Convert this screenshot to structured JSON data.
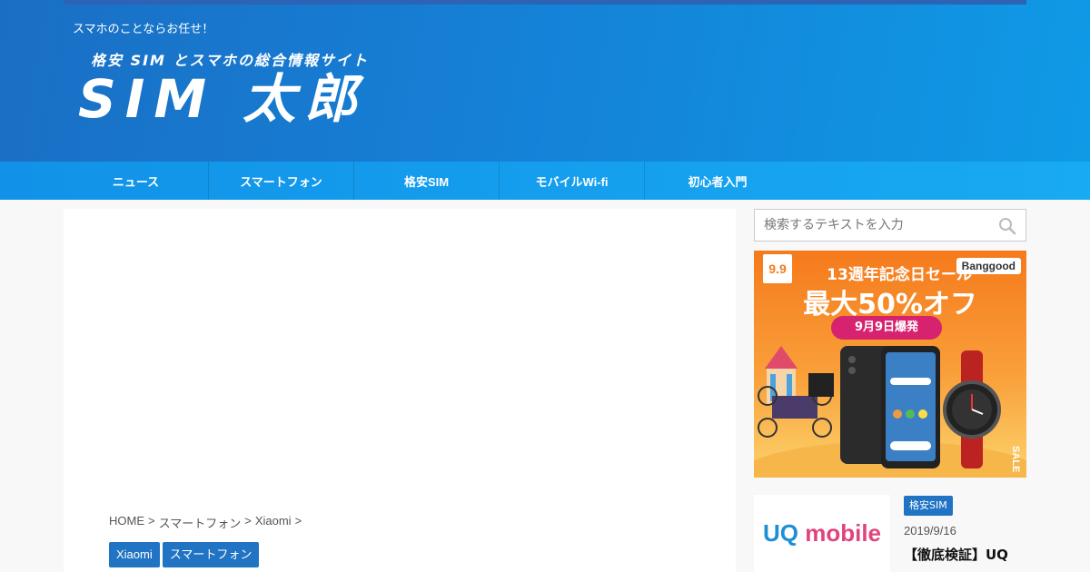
{
  "header": {
    "tagline": "スマホのことならお任せ！",
    "logo_sub": "格安 SIM とスマホの総合情報サイト",
    "logo_main": "SIM 太郎"
  },
  "nav": {
    "items": [
      {
        "label": "ニュース"
      },
      {
        "label": "スマートフォン"
      },
      {
        "label": "格安SIM"
      },
      {
        "label": "モバイルWi-fi"
      },
      {
        "label": "初心者入門"
      }
    ]
  },
  "breadcrumb": {
    "home": "HOME",
    "sep": ">",
    "level1": "スマートフォン",
    "level2": "Xiaomi"
  },
  "tags": [
    "Xiaomi",
    "スマートフォン"
  ],
  "search": {
    "placeholder": "検索するテキストを入力",
    "icon": "search-icon"
  },
  "banner": {
    "badge": "9.9",
    "brand": "Banggood",
    "line1": "13週年記念日セール",
    "line2": "最大50%オフ",
    "pill": "9月9日爆発",
    "side_text": "SALE"
  },
  "post": {
    "thumb_uq": "UQ",
    "thumb_mobile": " mobile",
    "category": "格安SIM",
    "date": "2019/9/16",
    "title": "【徹底検証】UQ"
  },
  "colors": {
    "header_blue": "#1580d6",
    "nav_blue": "#18aaf2",
    "tag_blue": "#2173c4",
    "banner_orange": "#f57a1c",
    "banner_pink": "#d7226f"
  }
}
